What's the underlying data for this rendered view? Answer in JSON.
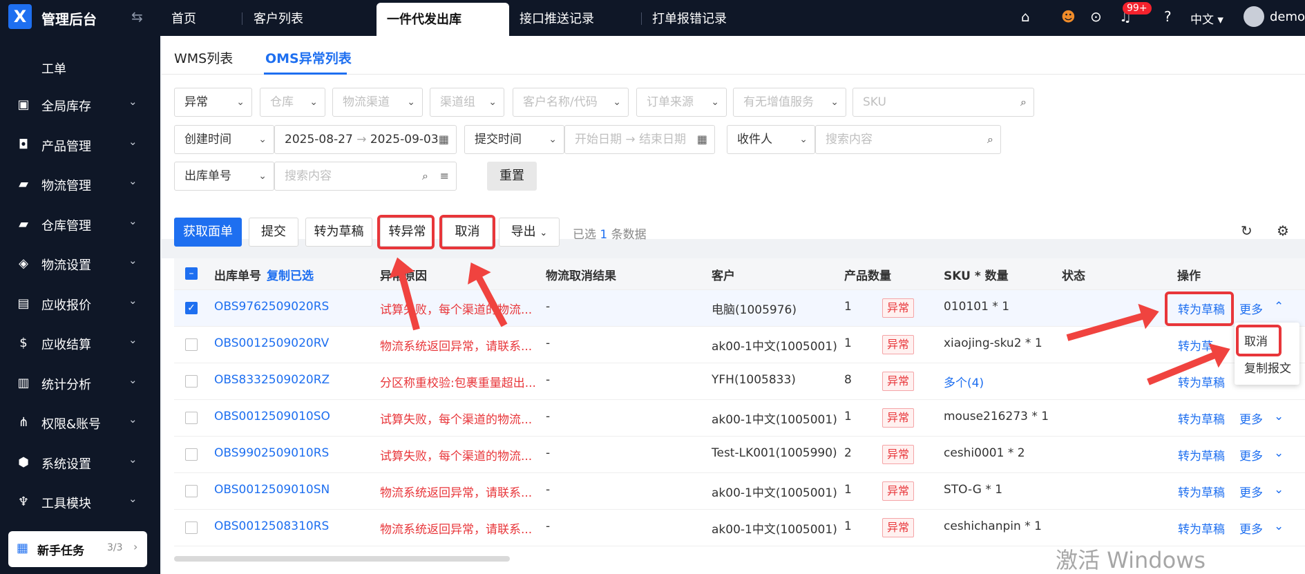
{
  "app": {
    "logo": "X",
    "title": "管理后台",
    "collapse_icon": "indent-icon"
  },
  "tabs": [
    "首页",
    "客户列表",
    "一件代发出库",
    "接口推送记录",
    "打单报错记录"
  ],
  "header": {
    "notify_count": "99+",
    "language": "中文",
    "user": "demo"
  },
  "sidebar": {
    "items": [
      "工单",
      "全局库存",
      "产品管理",
      "物流管理",
      "仓库管理",
      "物流设置",
      "应收报价",
      "应收结算",
      "统计分析",
      "权限&账号",
      "系统设置",
      "工具模块"
    ],
    "task_label": "新手任务",
    "task_progress": "3/3"
  },
  "subtabs": [
    "WMS列表",
    "OMS异常列表"
  ],
  "filters": {
    "status": "异常",
    "warehouse": "仓库",
    "channel": "物流渠道",
    "channel_group": "渠道组",
    "customer": "客户名称/代码",
    "order_source": "订单来源",
    "value_added": "有无增值服务",
    "sku_placeholder": "SKU",
    "create_time": "创建时间",
    "date_from": "2025-08-27",
    "date_to": "2025-09-03",
    "submit_time": "提交时间",
    "start_date": "开始日期",
    "end_date": "结束日期",
    "receiver": "收件人",
    "receiver_placeholder": "搜索内容",
    "order_no": "出库单号",
    "order_placeholder": "搜索内容",
    "reset": "重置"
  },
  "toolbar": {
    "get_label": "获取面单",
    "submit": "提交",
    "to_draft": "转为草稿",
    "to_exception": "转异常",
    "cancel": "取消",
    "export": "导出",
    "selected_prefix": "已选",
    "selected_count": "1",
    "selected_suffix": "条数据"
  },
  "columns": {
    "order_no": "出库单号",
    "copy_selected": "复制已选",
    "reason": "异常原因",
    "cancel_result": "物流取消结果",
    "customer": "客户",
    "qty": "产品数量",
    "sku": "SKU * 数量",
    "status": "状态",
    "action": "操作"
  },
  "rows": [
    {
      "order": "OBS9762509020RS",
      "reason": "试算失败，每个渠道的物流...",
      "cancel": "-",
      "customer": "电脑(1005976)",
      "qty": "1",
      "sku": "010101 * 1",
      "status": "异常",
      "action": "转为草稿",
      "more": "更多"
    },
    {
      "order": "OBS0012509020RV",
      "reason": "物流系统返回异常，请联系...",
      "cancel": "-",
      "customer": "ak00-1中文(1005001)",
      "qty": "1",
      "sku": "xiaojing-sku2 * 1",
      "status": "异常",
      "action": "转为草",
      "more": ""
    },
    {
      "order": "OBS8332509020RZ",
      "reason": "分区称重校验:包裹重量超出...",
      "cancel": "-",
      "customer": "YFH(1005833)",
      "qty": "8",
      "sku": "多个(4)",
      "status": "异常",
      "action": "转为草稿",
      "more": ""
    },
    {
      "order": "OBS0012509010SO",
      "reason": "试算失败，每个渠道的物流...",
      "cancel": "-",
      "customer": "ak00-1中文(1005001)",
      "qty": "1",
      "sku": "mouse216273 * 1",
      "status": "异常",
      "action": "转为草稿",
      "more": "更多"
    },
    {
      "order": "OBS9902509010RS",
      "reason": "试算失败，每个渠道的物流...",
      "cancel": "-",
      "customer": "Test-LK001(1005990)",
      "qty": "2",
      "sku": "ceshi0001 * 2",
      "status": "异常",
      "action": "转为草稿",
      "more": "更多"
    },
    {
      "order": "OBS0012509010SN",
      "reason": "物流系统返回异常，请联系...",
      "cancel": "-",
      "customer": "ak00-1中文(1005001)",
      "qty": "1",
      "sku": "STO-G * 1",
      "status": "异常",
      "action": "转为草稿",
      "more": "更多"
    },
    {
      "order": "OBS0012508310RS",
      "reason": "物流系统返回异常，请联系...",
      "cancel": "-",
      "customer": "ak00-1中文(1005001)",
      "qty": "1",
      "sku": "ceshichanpin * 1",
      "status": "异常",
      "action": "转为草稿",
      "more": "更多"
    }
  ],
  "more_menu": [
    "取消",
    "复制报文"
  ],
  "watermark": "激活 Windows",
  "colors": {
    "primary": "#1e6ff0",
    "danger": "#e8363a",
    "sidebar": "#0f1727"
  }
}
